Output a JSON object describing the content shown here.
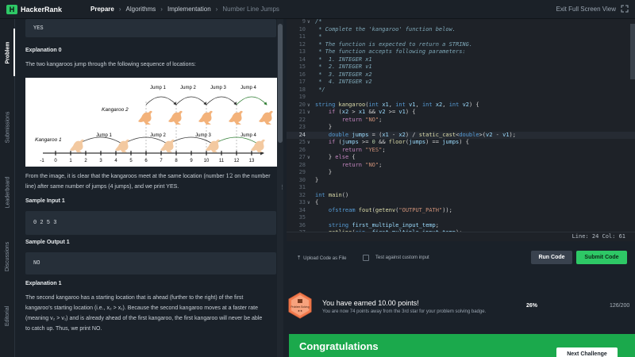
{
  "topbar": {
    "logo_text": "HackerRank",
    "crumbs": [
      "Prepare",
      "Algorithms",
      "Implementation",
      "Number Line Jumps"
    ],
    "exit_label": "Exit Full Screen View"
  },
  "vtabs": [
    "Problem",
    "Submissions",
    "Leaderboard",
    "Discussions",
    "Editorial"
  ],
  "problem": {
    "output0_value": "YES",
    "expl0_heading": "Explanation 0",
    "expl0_text": "The two kangaroos jump through the following sequence of locations:",
    "figure": {
      "kangaroo2_label": "Kangaroo 2",
      "kangaroo1_label": "Kangaroo 1",
      "top_jumps": [
        "Jump 1",
        "Jump 2",
        "Jump 3",
        "Jump 4"
      ],
      "bottom_jumps": [
        "Jump 1",
        "Jump 2",
        "Jump 3",
        "Jump 4"
      ],
      "ticks": [
        "-1",
        "0",
        "1",
        "2",
        "3",
        "4",
        "5",
        "6",
        "7",
        "8",
        "9",
        "10",
        "11",
        "12",
        "13"
      ]
    },
    "expl0_conclusion_1": "From the image, it is clear that the kangaroos meet at the same location (number ",
    "expl0_conclusion_num": "12",
    "expl0_conclusion_2": " on the number line) after same number of jumps (4 jumps), and we print YES.",
    "sample_input1_heading": "Sample Input 1",
    "sample_input1_value": "0 2 5 3",
    "sample_output1_heading": "Sample Output 1",
    "sample_output1_value": "NO",
    "expl1_heading": "Explanation 1",
    "expl1_line1": "The second kangaroo has a starting location that is ahead (further to the right) of the first",
    "expl1_line2": "kangaroo's starting location (i.e., x₂ > x₁). Because the second kangaroo moves at a faster rate",
    "expl1_line3": "(meaning v₂ > v₁) and is already ahead of the first kangaroo, the first kangaroo will never be able",
    "expl1_line4": "to catch up. Thus, we print NO."
  },
  "editor": {
    "status": "Line: 24 Col: 61",
    "lines": [
      {
        "n": "9",
        "t": "/*"
      },
      {
        "n": "10",
        "t": " * Complete the 'kangaroo' function below."
      },
      {
        "n": "11",
        "t": " *"
      },
      {
        "n": "12",
        "t": " * The function is expected to return a STRING."
      },
      {
        "n": "13",
        "t": " * The function accepts following parameters:"
      },
      {
        "n": "14",
        "t": " *  1. INTEGER x1"
      },
      {
        "n": "15",
        "t": " *  2. INTEGER v1"
      },
      {
        "n": "16",
        "t": " *  3. INTEGER x2"
      },
      {
        "n": "17",
        "t": " *  4. INTEGER v2"
      },
      {
        "n": "18",
        "t": " */"
      },
      {
        "n": "19",
        "t": ""
      },
      {
        "n": "20",
        "t": "string kangaroo(int x1, int v1, int x2, int v2) {"
      },
      {
        "n": "21",
        "t": "    if (x2 > x1 && v2 >= v1) {"
      },
      {
        "n": "22",
        "t": "        return \"NO\";"
      },
      {
        "n": "23",
        "t": "    }"
      },
      {
        "n": "24",
        "t": "    double jumps = (x1 - x2) / static_cast<double>(v2 - v1);"
      },
      {
        "n": "25",
        "t": "    if (jumps >= 0 && floor(jumps) == jumps) {"
      },
      {
        "n": "26",
        "t": "        return \"YES\";"
      },
      {
        "n": "27",
        "t": "    } else {"
      },
      {
        "n": "28",
        "t": "        return \"NO\";"
      },
      {
        "n": "29",
        "t": "    }"
      },
      {
        "n": "30",
        "t": "}"
      },
      {
        "n": "31",
        "t": ""
      },
      {
        "n": "32",
        "t": "int main()"
      },
      {
        "n": "33",
        "t": "{"
      },
      {
        "n": "34",
        "t": "    ofstream fout(getenv(\"OUTPUT_PATH\"));"
      },
      {
        "n": "35",
        "t": ""
      },
      {
        "n": "36",
        "t": "    string first_multiple_input_temp;"
      },
      {
        "n": "37",
        "t": "    getline(cin, first_multiple_input_temp);"
      }
    ]
  },
  "actions": {
    "upload_label": "Upload Code as File",
    "custom_input_label": "Test against custom input",
    "run_label": "Run Code",
    "submit_label": "Submit Code"
  },
  "earned": {
    "badge_label": "Problem Solving",
    "title": "You have earned 10.00 points!",
    "subtitle": "You are now 74 points away from the 3rd star for your problem solving badge.",
    "percent": "26%",
    "fraction": "126/200"
  },
  "congrats": {
    "title": "Congratulations",
    "next_label": "Next Challenge"
  },
  "colors": {
    "accent_green": "#2ec866",
    "congrats_green": "#1ba94c",
    "badge_orange": "#f27c4f"
  }
}
